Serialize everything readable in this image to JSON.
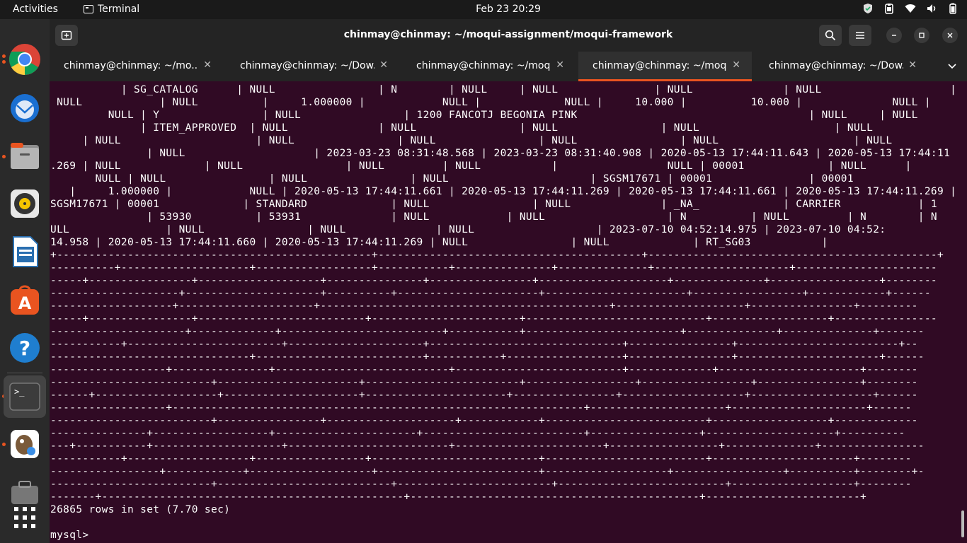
{
  "topbar": {
    "activities": "Activities",
    "app_name": "Terminal",
    "clock": "Feb 23  20:29",
    "tray_icons": [
      "shield-icon",
      "clipboard-icon",
      "wifi-icon",
      "volume-icon",
      "battery-icon"
    ]
  },
  "dock": {
    "items": [
      {
        "name": "chrome-icon",
        "running": true
      },
      {
        "name": "thunderbird-icon",
        "running": false
      },
      {
        "name": "files-icon",
        "running": true
      },
      {
        "name": "rhythmbox-icon",
        "running": false
      },
      {
        "name": "libreoffice-writer-icon",
        "running": false
      },
      {
        "name": "app-center-icon",
        "running": false
      },
      {
        "name": "help-icon",
        "running": false
      },
      {
        "name": "terminal-icon",
        "running": true
      },
      {
        "name": "dbeaver-icon",
        "running": true
      },
      {
        "name": "toolbox-icon",
        "running": false
      },
      {
        "name": "show-apps-icon",
        "running": false
      }
    ]
  },
  "window": {
    "title": "chinmay@chinmay: ~/moqui-assignment/moqui-framework",
    "tabs": [
      {
        "label": "chinmay@chinmay: ~/mo...",
        "active": false
      },
      {
        "label": "chinmay@chinmay: ~/Dow...",
        "active": false
      },
      {
        "label": "chinmay@chinmay: ~/moq...",
        "active": false
      },
      {
        "label": "chinmay@chinmay: ~/moq...",
        "active": true
      },
      {
        "label": "chinmay@chinmay: ~/Dow...",
        "active": false
      }
    ]
  },
  "terminal": {
    "lines": [
      "           | SG_CATALOG      | NULL                | N        | NULL     | NULL               | NULL              | NULL                    |",
      " NULL            | NULL          |     1.000000 |            NULL |             NULL |     10.000 |          10.000 |              NULL |",
      "         NULL | Y                | NULL                | 1200 FANCOTJ BEGONIA PINK                                    | NULL     | NULL",
      "              | ITEM_APPROVED  | NULL              | NULL                | NULL                | NULL                     | NULL",
      "     | NULL                     | NULL                | NULL                | NULL                | NULL                     | NULL",
      "               | NULL                    | 2023-03-23 08:31:48.568 | 2023-03-23 08:31:40.908 | 2020-05-13 17:44:11.643 | 2020-05-13 17:44:11",
      ".269 | NULL             | NULL                | NULL         | NULL           |                 NULL | 00001             | NULL      |",
      "       NULL | NULL                | NULL                | NULL                      | SGSM17671 | 00001               | 00001",
      "   |     1.000000 |            NULL | 2020-05-13 17:44:11.661 | 2020-05-13 17:44:11.269 | 2020-05-13 17:44:11.661 | 2020-05-13 17:44:11.269 |",
      "SGSM17671 | 00001             | STANDARD             | NULL                | NULL              | _NA_             | CARRIER            | 1",
      "               | 53930          | 53931              | NULL            | NULL                   | N          | NULL         | N        | N",
      "ULL               | NULL                | NULL              | NULL                   | 2023-07-10 04:52:14.975 | 2023-07-10 04:52:",
      "14.958 | 2020-05-13 17:44:11.660 | 2020-05-13 17:44:11.269 | NULL                | NULL             | RT_SG03           |",
      "+-------------------------------------------------+-----------------------------------------+---------------------------------------------+",
      "----------+--------------------+------------------+-----------+---------------+--------------+---------------------+----------------------",
      "-----+----------------+-------------------+---------------+----------------+--------------------+--------------+-----------------+--------",
      "--------------------+---------------------+----------+----------------------+----------------------+-----------------+------------+------",
      "-------------------+---------------------+---------------------------------------------+--------------------+----------------+---------",
      "-----+----------------+--------------------------+-----------------------+----------------------------+------------------+----------------",
      "---------------------+-------------+-------------------------+-----------+------------------------+--------------+--------------+-------",
      "-----------+------------------------+---------------------+------------------------------+----------------+-------------------------+--",
      "-------------------------------+--------------------------+-----------+------------------+----------------+----------------------+------",
      "------------------+---------------+---------------------------+--------------------------+-------------+----------------------+--------",
      "-------------------------+----------------------+------------------------+-----------------+-----------------+----------------+--------",
      "------+-------------------+---------------------+----------------------+----------------+-------------------+-------------------+------",
      "------------------+----------------------------------------------------------------+---------------------+---------------------+------",
      "-------------------------+----------------+--------------------+------------+-------------------------+------------------+-------------",
      "---------------+------------------+----------------------+-------------------------+-----------------+--------------------+----------",
      "---+-----------+--------------------+-------------------------+-----------------------+-----------------+--------------+----------------",
      "-----------+-------------------+-----------------+--------------------------+-------------------------+----------------------+--------",
      "-----------------+------------+-------------------+-------------------------+-------------------+-----------------+----------+--------+-",
      "-------------------------+---------------------------+------------------------+--------------------------+-------------------+--------",
      "-------+-----------------------------------------------+---------------------------------------------+------------------------+",
      "26865 rows in set (7.70 sec)",
      "",
      "mysql> "
    ]
  }
}
